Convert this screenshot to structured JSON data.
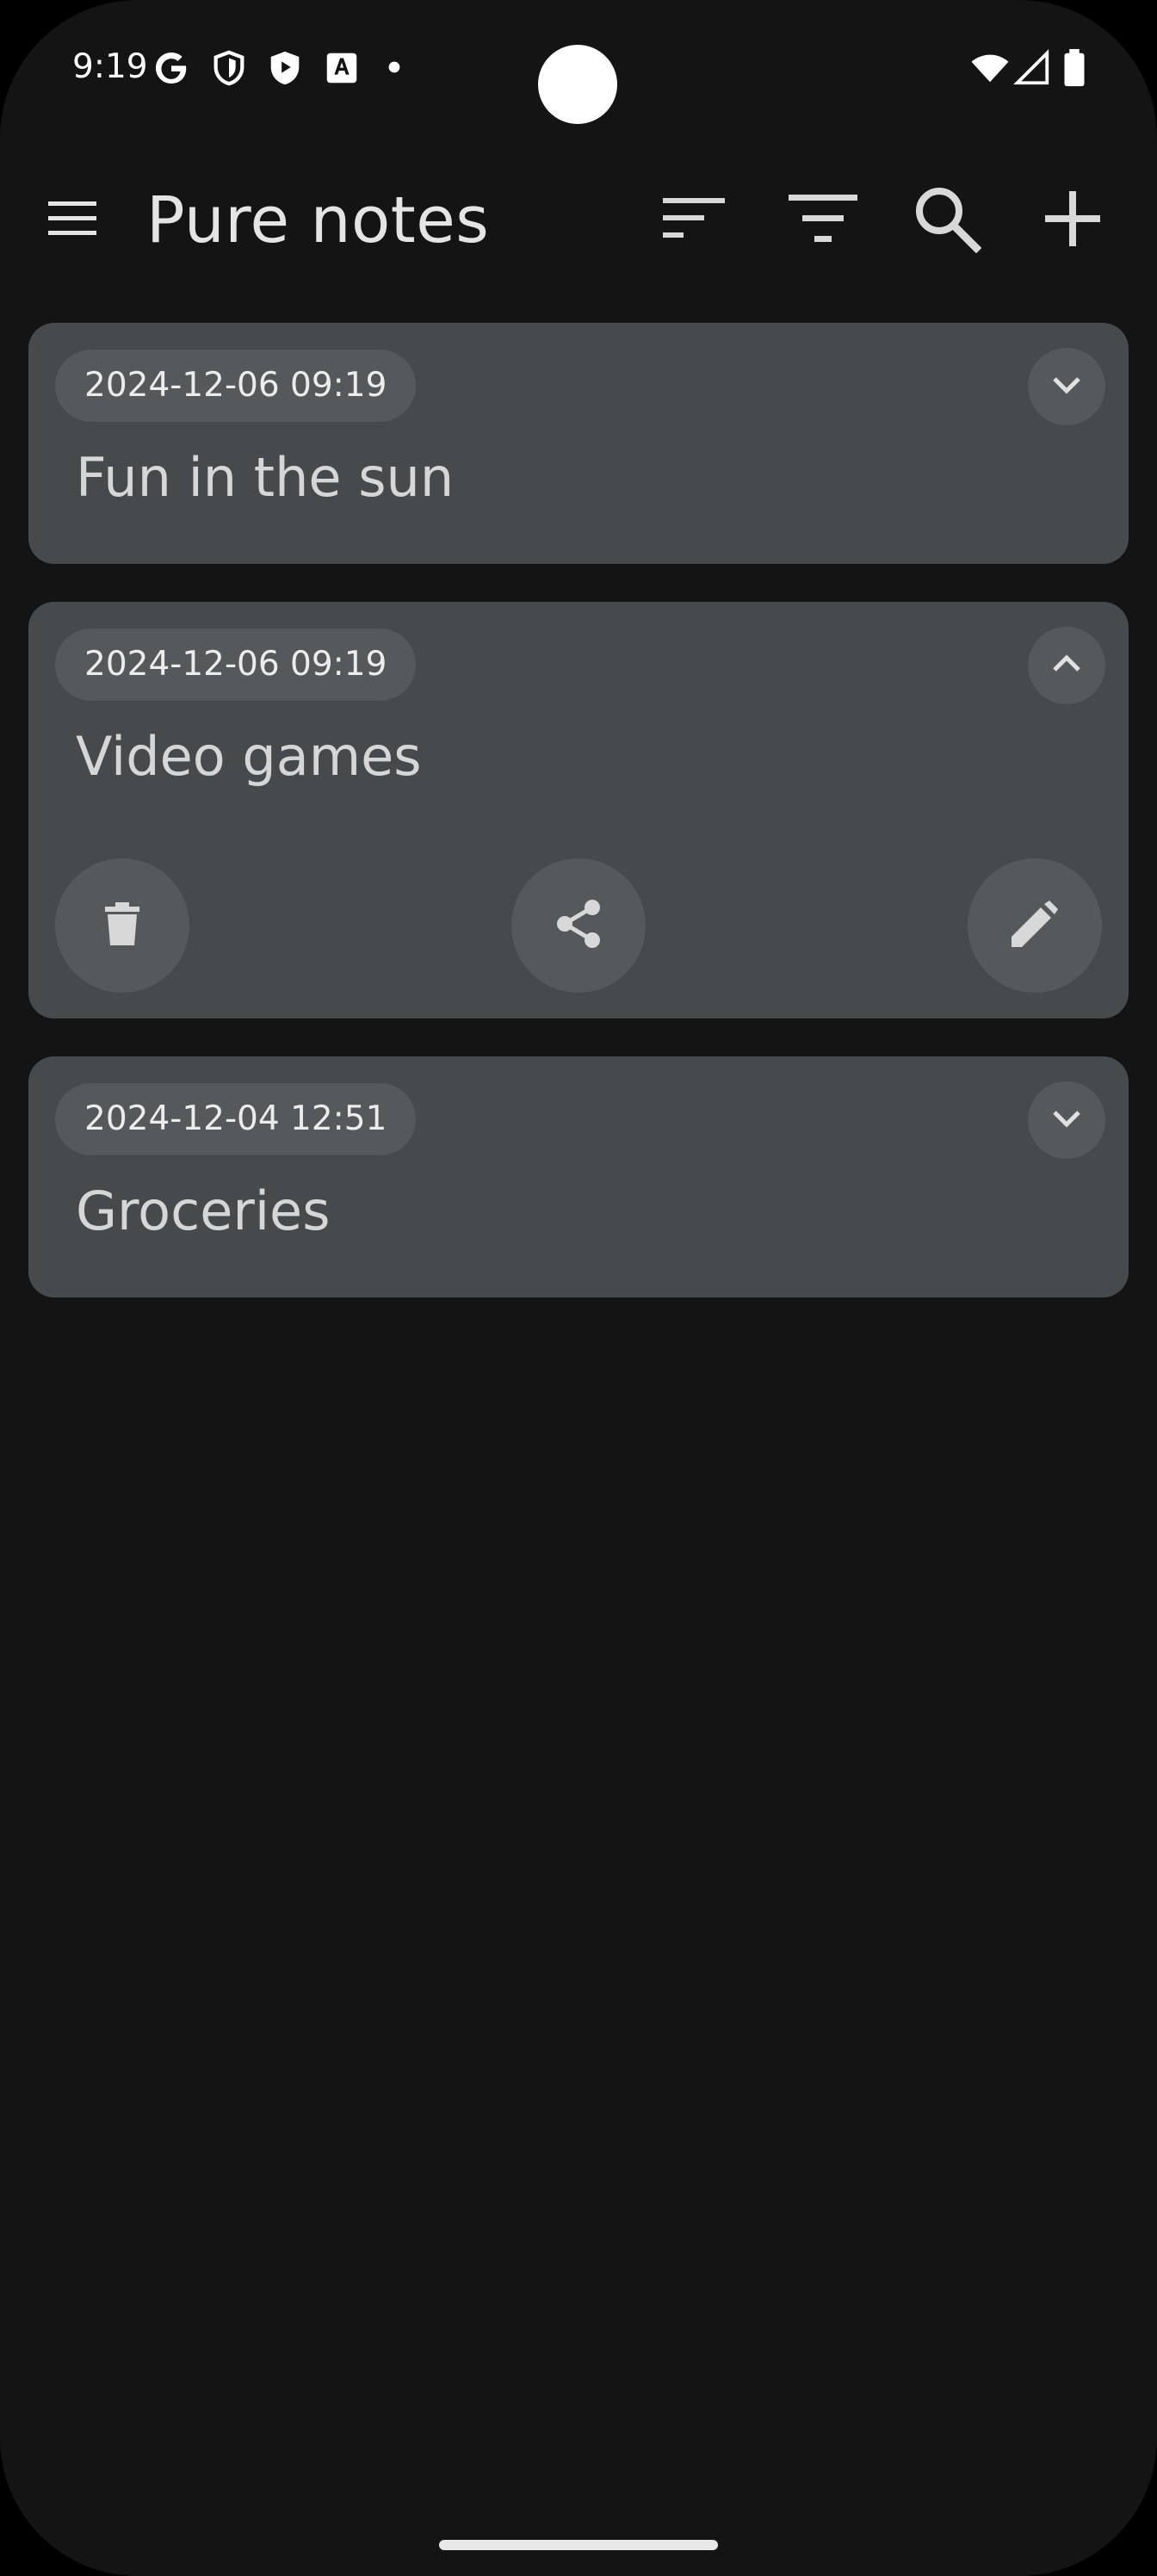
{
  "status_bar": {
    "time": "9:19",
    "left_icons": [
      "google-icon",
      "shield-icon",
      "play-protect-icon",
      "translate-icon",
      "dot-icon"
    ],
    "right_icons": [
      "wifi-icon",
      "signal-icon",
      "battery-icon"
    ]
  },
  "app_bar": {
    "title": "Pure notes",
    "menu_icon": "hamburger-menu-icon",
    "sort_icon": "sort-icon",
    "filter_icon": "filter-icon",
    "search_icon": "search-icon",
    "add_icon": "add-icon"
  },
  "notes": [
    {
      "date": "2024-12-06 09:19",
      "title": "Fun in the sun",
      "expanded": false
    },
    {
      "date": "2024-12-06 09:19",
      "title": "Video games",
      "expanded": true
    },
    {
      "date": "2024-12-04 12:51",
      "title": "Groceries",
      "expanded": false
    }
  ],
  "note_actions": {
    "delete_icon": "trash-icon",
    "share_icon": "share-icon",
    "edit_icon": "pencil-icon"
  },
  "colors": {
    "background": "#141414",
    "card": "#464a4c",
    "chip": "#55595b",
    "text": "#e4e4e4"
  }
}
